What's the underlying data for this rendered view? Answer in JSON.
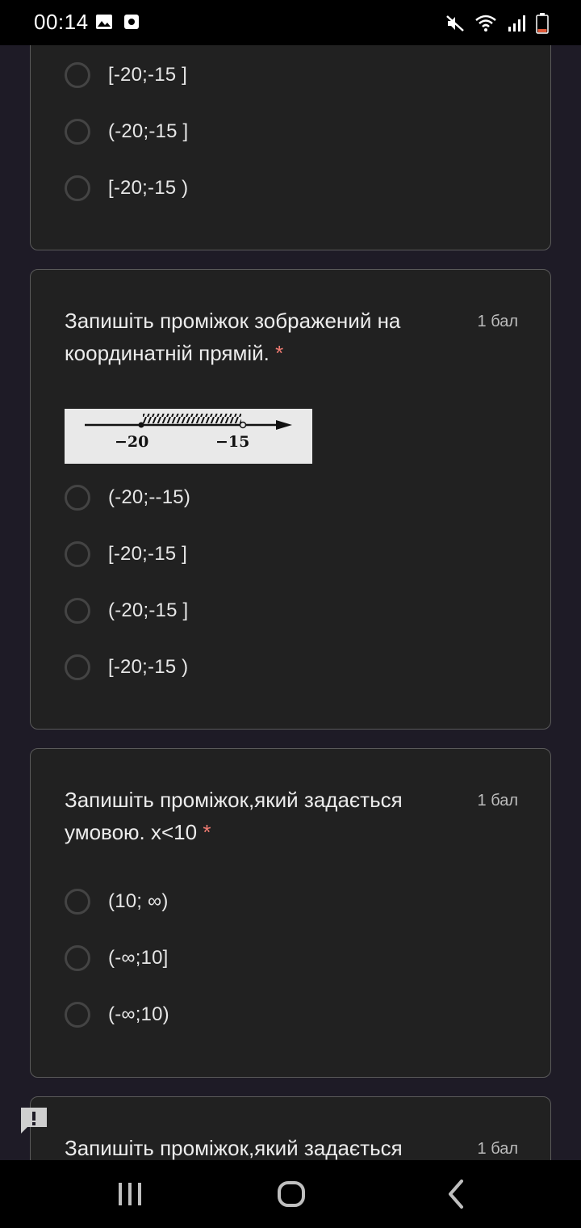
{
  "status_bar": {
    "time": "00:14",
    "left_icons": [
      "image-icon",
      "screenshot-icon"
    ],
    "right_icons": [
      "mute-icon",
      "wifi-icon",
      "signal-icon",
      "battery-icon"
    ]
  },
  "questions": [
    {
      "title": "",
      "points": "",
      "options": [
        "[-20;-15 ]",
        "(-20;-15 ]",
        "[-20;-15 )"
      ]
    },
    {
      "title": "Запишіть проміжок зображений на координатній прямій.",
      "required_mark": "*",
      "points": "1 бал",
      "figure": {
        "left_label": "−20",
        "right_label": "−15"
      },
      "options": [
        "(-20;--15)",
        "[-20;-15 ]",
        "(-20;-15 ]",
        "[-20;-15 )"
      ]
    },
    {
      "title": "Запишіть проміжок,який задається умовою. x<10",
      "required_mark": "*",
      "points": "1 бал",
      "options": [
        "(10; ∞)",
        "(-∞;10]",
        "(-∞;10)"
      ]
    },
    {
      "title": "Запишіть проміжок,який задається",
      "points": "1 бал"
    }
  ],
  "nav": {
    "buttons": [
      "recent-apps-icon",
      "home-icon",
      "back-icon"
    ]
  },
  "colors": {
    "background": "#1e1b26",
    "card": "#212121",
    "required": "#f07b72"
  }
}
